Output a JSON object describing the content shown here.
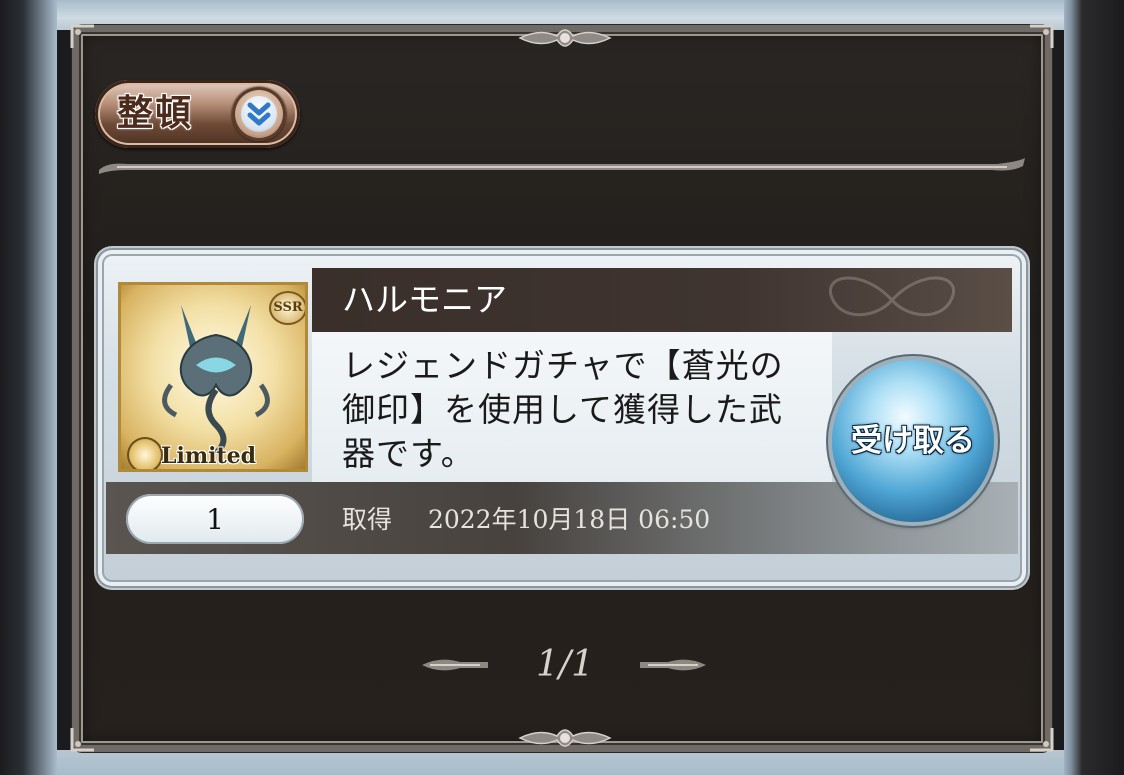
{
  "sort": {
    "label": "整頓",
    "icon": "double-chevron-down-icon"
  },
  "item": {
    "name": "ハルモニア",
    "rarity": "SSR",
    "tag": "Limited",
    "description": "レジェンドガチャで【蒼光の御印】を使用して獲得した武器です。",
    "quantity": "1",
    "acquired_label": "取得",
    "acquired_date": "2022年10月18日 06:50"
  },
  "receive_button": {
    "label": "受け取る"
  },
  "pagination": {
    "text": "1/1"
  },
  "colors": {
    "panel": "#24201d",
    "frame": "#9e978f",
    "name_bar": "#3a2f2a",
    "receive_button": "#4fa6d4",
    "sort_button": "#b78e78"
  }
}
